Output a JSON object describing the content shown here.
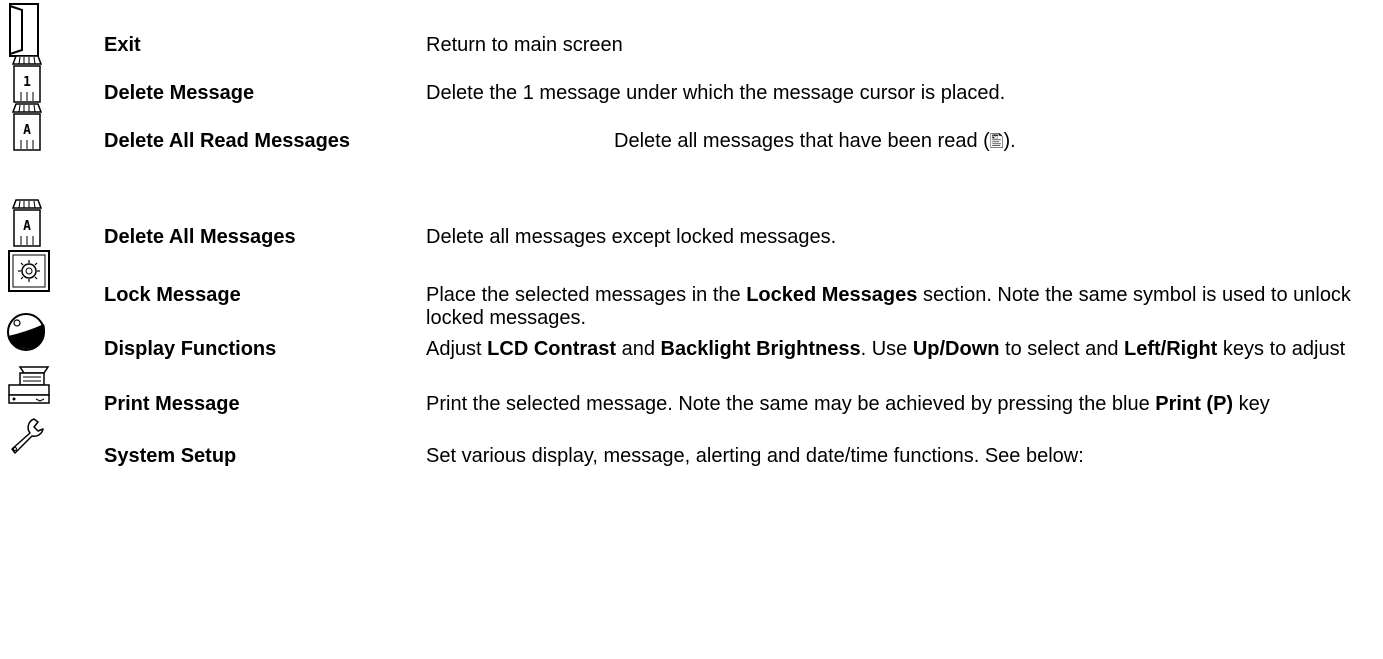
{
  "icons": {
    "exit": "door-icon",
    "delete_message": "trash-can-1-icon",
    "delete_all_read": "trash-can-a-icon",
    "delete_all": "trash-can-a-icon",
    "lock": "safe-lock-icon",
    "display": "contrast-icon",
    "print": "printer-icon",
    "setup": "wrench-icon"
  },
  "items": [
    {
      "term": "Exit",
      "desc": "Return to main screen"
    },
    {
      "term": "Delete Message",
      "desc": "Delete the 1 message under which the message cursor is placed."
    },
    {
      "term": "Delete All Read Messages",
      "desc_1": "Delete all messages that have been read (",
      "glyph": "🖺",
      "desc_2": ")."
    },
    {
      "term": "Delete All Messages",
      "desc": "Delete all messages except locked messages."
    },
    {
      "term": "Lock Message",
      "desc_1": "Place the selected messages in the ",
      "bold_1": "Locked Messages",
      "desc_2": " section.  Note the same symbol is used to unlock locked messages."
    },
    {
      "term": "Display Functions",
      "desc_1": "Adjust ",
      "bold_1": "LCD Contrast",
      "desc_2": " and ",
      "bold_2": "Backlight Brightness",
      "desc_3": ".  Use ",
      "bold_3": "Up/Down",
      "desc_4": " to select and ",
      "bold_4": "Left/Right",
      "desc_5": " keys to adjust"
    },
    {
      "term": "Print Message",
      "desc_1": "Print the selected message.  Note the same may be achieved by pressing the blue ",
      "bold_1": "Print (P)",
      "desc_2": " key"
    },
    {
      "term": "System Setup",
      "desc": "Set various display,  message, alerting and date/time functions.  See below:"
    }
  ]
}
